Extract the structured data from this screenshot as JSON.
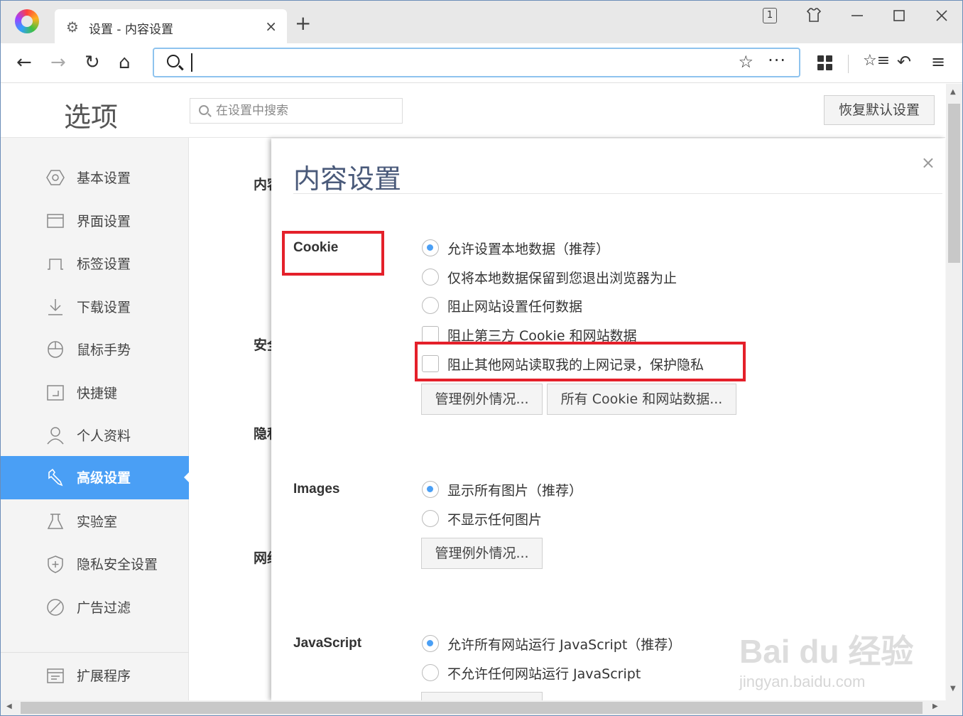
{
  "tab": {
    "title": "设置 - 内容设置",
    "close": "×",
    "new_tab": "+"
  },
  "window": {
    "tab_count": "1"
  },
  "toolbar": {
    "back": "←",
    "forward": "→",
    "reload": "↻",
    "home": "⌂",
    "star": "☆",
    "more": "···",
    "undo": "↶",
    "menu": "≡",
    "favorites": "☆≡"
  },
  "settings": {
    "title": "选项",
    "search_placeholder": "在设置中搜索",
    "restore_label": "恢复默认设置"
  },
  "sidebar": {
    "items": [
      {
        "label": "基本设置",
        "icon": "hexagon-icon"
      },
      {
        "label": "界面设置",
        "icon": "window-icon"
      },
      {
        "label": "标签设置",
        "icon": "tab-icon"
      },
      {
        "label": "下载设置",
        "icon": "download-icon"
      },
      {
        "label": "鼠标手势",
        "icon": "mouse-icon"
      },
      {
        "label": "快捷键",
        "icon": "shortcut-icon"
      },
      {
        "label": "个人资料",
        "icon": "person-icon"
      },
      {
        "label": "高级设置",
        "icon": "wrench-icon",
        "active": true
      },
      {
        "label": "实验室",
        "icon": "flask-icon"
      },
      {
        "label": "隐私安全设置",
        "icon": "shield-icon"
      },
      {
        "label": "广告过滤",
        "icon": "block-icon"
      },
      {
        "label": "扩展程序",
        "icon": "extension-icon"
      }
    ]
  },
  "background_labels": [
    "内容",
    "安全",
    "隐私",
    "网络"
  ],
  "dialog": {
    "title": "内容设置",
    "close": "×",
    "cookie": {
      "label": "Cookie",
      "opt1": "允许设置本地数据（推荐）",
      "opt2": "仅将本地数据保留到您退出浏览器为止",
      "opt3": "阻止网站设置任何数据",
      "check1": "阻止第三方 Cookie 和网站数据",
      "check2": "阻止其他网站读取我的上网记录，保护隐私",
      "btn_exceptions": "管理例外情况...",
      "btn_all": "所有 Cookie 和网站数据..."
    },
    "images": {
      "label": "Images",
      "opt1": "显示所有图片（推荐）",
      "opt2": "不显示任何图片",
      "btn_exceptions": "管理例外情况..."
    },
    "javascript": {
      "label": "JavaScript",
      "opt1": "允许所有网站运行 JavaScript（推荐）",
      "opt2": "不允许任何网站运行 JavaScript"
    }
  },
  "watermark": {
    "line1": "Bai du 经验",
    "line2": "jingyan.baidu.com"
  },
  "colors": {
    "accent": "#4a9ff5",
    "highlight": "#e4202a",
    "title": "#4a5a7a"
  }
}
